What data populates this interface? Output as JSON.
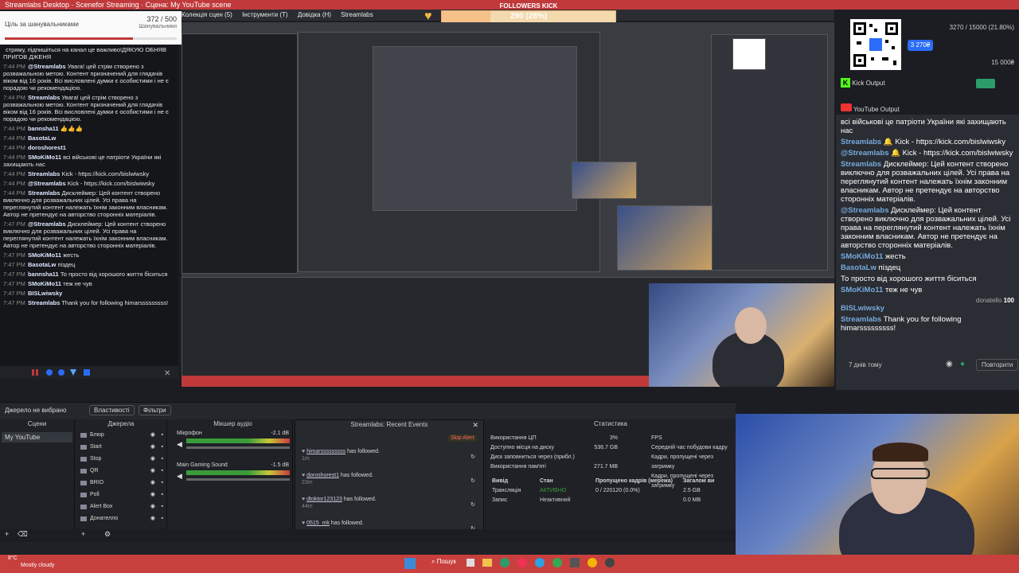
{
  "titlebar": {
    "app_title": "Streamlabs Desktop · Scenefor Streaming · Сцена: My YouTube scene"
  },
  "menubar": {
    "items": [
      "Колекція сцен (5)",
      "Інструменти (T)",
      "Довідка (H)",
      "Streamlabs"
    ]
  },
  "goal_widget": {
    "title": "Ціль за шанувальниками",
    "count": "372 / 500",
    "subtitle": "Шанувальники",
    "progress": 0.744
  },
  "followers_kick": {
    "title": "FOLLOWERS KICK",
    "value_text": "290 (28%)",
    "min": "0",
    "max": "1000",
    "progress": 0.28
  },
  "left_chat": {
    "messages": [
      {
        "time": "",
        "user": "",
        "text": "стряму, підпишіться на канал це важливо!ДЯКУЮ ОБНЯВ ПРИГОВ ДЖЕНЯ"
      },
      {
        "time": "7:44 PM",
        "user": "@Streamlabs",
        "text": "Увага! цей стрім створено з розважальною метою. Контент призначений для глядачів віком від 16 років. Всі висловлені думки є особистими і не є порадою чи рекомендацією."
      },
      {
        "time": "7:44 PM",
        "user": "Streamlabs",
        "text": "Увага! цей стрім створено з розважальною метою. Контент призначений для глядачів віком від 16 років. Всі висловлені думки є особистими і не є порадою чи рекомендацією."
      },
      {
        "time": "7:44 PM",
        "user": "bannsha11",
        "text": "👍👍👍"
      },
      {
        "time": "7:44 PM",
        "user": "BasotaLw",
        "text": ""
      },
      {
        "time": "7:44 PM",
        "user": "doroshorest1",
        "text": ""
      },
      {
        "time": "7:44 PM",
        "user": "SMoKiMo11",
        "text": "всі військові це патріоти України які захищають нас"
      },
      {
        "time": "7:44 PM",
        "user": "Streamlabs",
        "text": "Kick - https://kick.com/bislwiwsky"
      },
      {
        "time": "7:44 PM",
        "user": "@Streamlabs",
        "text": "Kick - https://kick.com/bislwiwsky"
      },
      {
        "time": "7:44 PM",
        "user": "Streamlabs",
        "text": "Дисклеймер: Цей контент створено виключно для розважальних цілей. Усі права на переглянутий контент належать їхнім законним власникам. Автор не претендує на авторство сторонніх матеріалів."
      },
      {
        "time": "7:47 PM",
        "user": "@Streamlabs",
        "text": "Дисклеймер: Цей контент створено виключно для розважальних цілей. Усі права на переглянутий контент належать їхнім законним власникам. Автор не претендує на авторство сторонніх матеріалів."
      },
      {
        "time": "7:47 PM",
        "user": "SMoKiMo11",
        "text": "жесть"
      },
      {
        "time": "7:47 PM",
        "user": "BasotaLw",
        "text": "піздец"
      },
      {
        "time": "7:47 PM",
        "user": "bannsha11",
        "text": "То просто від хорошого життя біситься"
      },
      {
        "time": "7:47 PM",
        "user": "SMoKiMo11",
        "text": "теж не чув"
      },
      {
        "time": "7:47 PM",
        "user": "BISLwiwsky",
        "text": ""
      },
      {
        "time": "7:47 PM",
        "user": "Streamlabs",
        "text": "Thank you for following himarsssssssss!"
      }
    ]
  },
  "right_panel": {
    "goal2": {
      "value": "3270 / 15000 (21.80%)",
      "pill": "3 270₴",
      "max": "15 000₴"
    },
    "kick_output": "Kick Output",
    "youtube_output": "YouTube Output",
    "messages": [
      {
        "user": "",
        "text": "всі військові це патріоти України які захищають нас"
      },
      {
        "user": "Streamlabs",
        "text": "🔔 Kick - https://kick.com/bislwiwsky"
      },
      {
        "user": "@Streamlabs",
        "text": "🔔 Kick - https://kick.com/bislwiwsky"
      },
      {
        "user": "Streamlabs",
        "text": "Дисклеймер: Цей контент створено виключно для розважальних цілей. Усі права на переглянутий контент належать їхнім законним власникам. Автор не претендує на авторство сторонніх матеріалів."
      },
      {
        "user": "@Streamlabs",
        "text": "Дисклеймер: Цей контент створено виключно для розважальних цілей. Усі права на переглянутий контент належать їхнім законним власникам. Автор не претендує на авторство сторонніх матеріалів."
      },
      {
        "user": "SMoKiMo11",
        "text": "жесть"
      },
      {
        "user": "BasotaLw",
        "text": "піздец"
      },
      {
        "user": "",
        "text": "То просто від хорошого життя біситься"
      },
      {
        "user": "SMoKiMo11",
        "text": "теж не чув"
      },
      {
        "user": "BISLwiwsky",
        "text": ""
      },
      {
        "user": "Streamlabs",
        "text": "Thank you for following himarsssssssss!"
      }
    ],
    "donation_label": "donatello",
    "donation_amount": "100",
    "footer_time": "7 днів тому",
    "retry_label": "Повторити"
  },
  "source_bar": {
    "no_selection": "Джерело не вибрано",
    "properties": "Властивості",
    "filters": "Фільтри"
  },
  "scenes": {
    "title": "Сцени",
    "items": [
      "My YouTube"
    ]
  },
  "sources": {
    "title": "Джерела",
    "items": [
      "Блюр",
      "Start",
      "Stop",
      "QR",
      "BRIO",
      "Poll",
      "Alert Box",
      "Донателло"
    ]
  },
  "mixer": {
    "title": "Мікшер аудіо",
    "channels": [
      {
        "name": "Мікрофон",
        "db": "-2.1 dB"
      },
      {
        "name": "Main Gaming Sound",
        "db": "-1.5 dB"
      }
    ]
  },
  "recent_events": {
    "title": "Streamlabs: Recent Events",
    "skip_alert": "Skip Alert",
    "events": [
      {
        "user": "himarsssssssss",
        "action": "has followed.",
        "age": "1m"
      },
      {
        "user": "doroshorest1",
        "action": "has followed.",
        "age": "23m"
      },
      {
        "user": "dtoktor123123",
        "action": "has followed.",
        "age": "44m"
      },
      {
        "user": "0515_mk",
        "action": "has followed.",
        "age": ""
      }
    ]
  },
  "stats": {
    "title": "Статистика",
    "rows": [
      {
        "label": "Використання ЦП",
        "value": "3%"
      },
      {
        "label": "Доступно місця на диску",
        "value": "536.7 GB"
      },
      {
        "label": "Диск заповниться через (прибл.)",
        "value": ""
      },
      {
        "label": "Використання пам'яті",
        "value": "271.7 MB"
      }
    ],
    "right_rows": [
      {
        "label": "FPS",
        "value": ""
      },
      {
        "label": "Середній час побудови кадру",
        "value": ""
      },
      {
        "label": "Кадри, пропущені через затримку",
        "value": ""
      },
      {
        "label": "Кадри, пропущені через затримку",
        "value": ""
      }
    ],
    "table_headers": [
      "Вивід",
      "Стан",
      "Пропущено кадрів (мережа)",
      "Загалом ви"
    ],
    "table_rows": [
      {
        "name": "Трансляція",
        "state": "АКТИВНО",
        "dropped": "0 / 220120 (0.0%)",
        "total": "2.5 GB"
      },
      {
        "name": "Запис",
        "state": "Неактивний",
        "dropped": "",
        "total": "0.0 MB"
      }
    ]
  },
  "taskbar": {
    "weather_temp": "8°C",
    "weather_desc": "Mostly cloudy",
    "search": "Пошук"
  }
}
